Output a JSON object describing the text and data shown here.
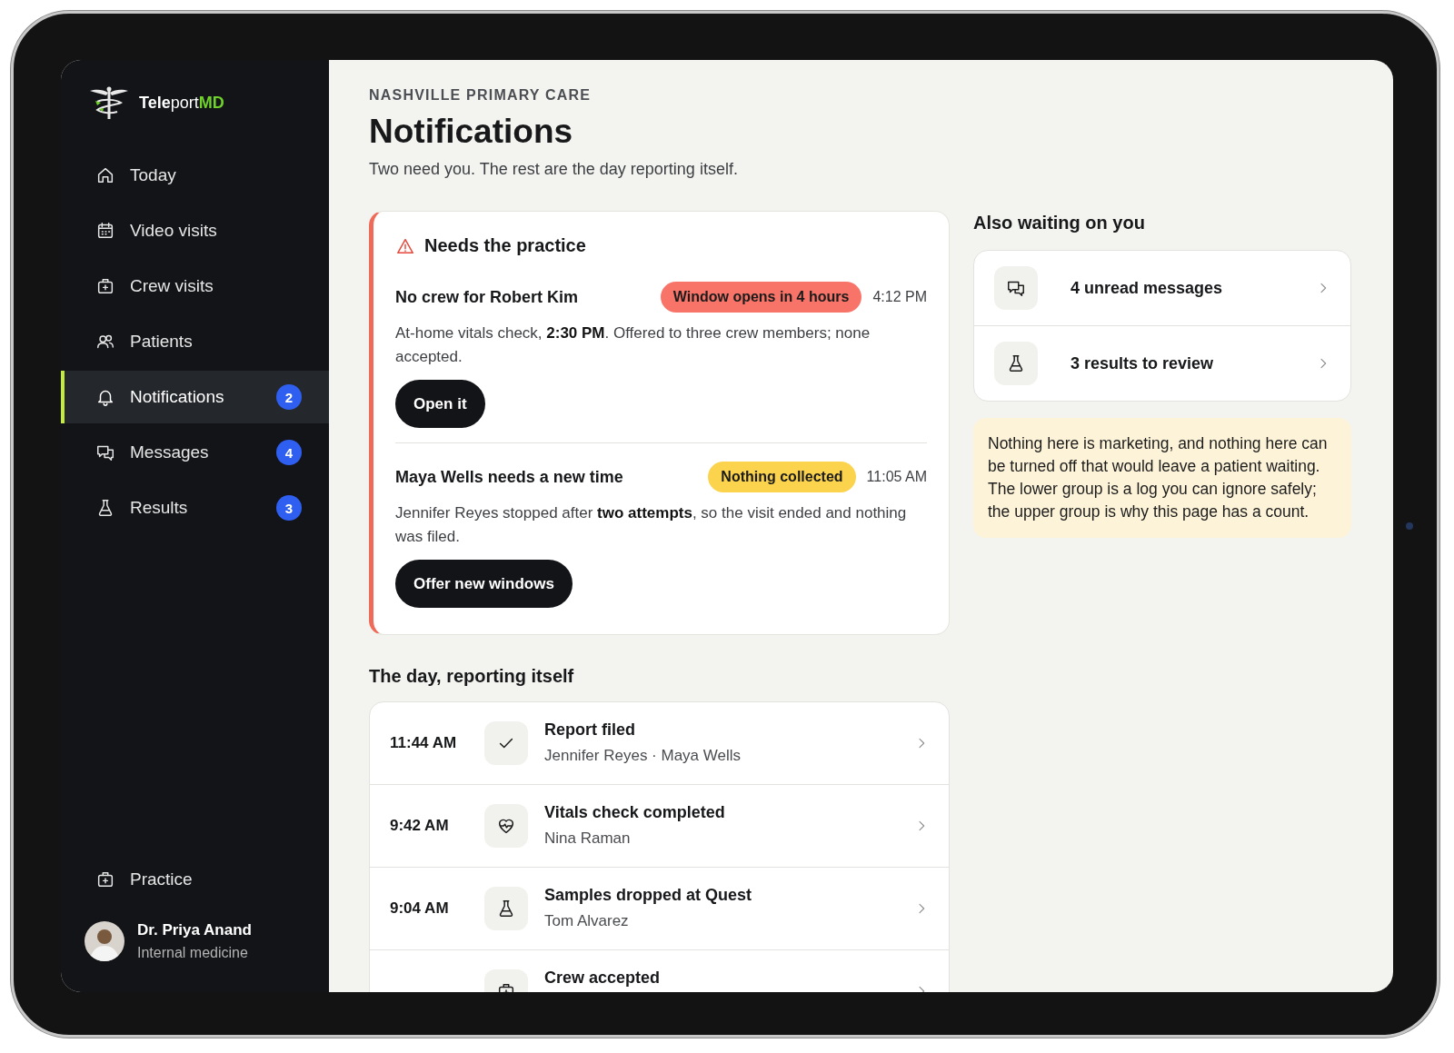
{
  "brand": {
    "name": "**Tele**port",
    "suffix": "MD"
  },
  "nav": [
    {
      "label": "Today",
      "kind": "home",
      "selected": false
    },
    {
      "label": "Video visits",
      "kind": "calendar",
      "selected": false
    },
    {
      "label": "Crew visits",
      "kind": "kit",
      "selected": false
    },
    {
      "label": "Patients",
      "kind": "people",
      "selected": false
    },
    {
      "label": "Notifications",
      "kind": "bell",
      "selected": true,
      "badge": "2"
    },
    {
      "label": "Messages",
      "kind": "chat",
      "selected": false,
      "badge": "4"
    },
    {
      "label": "Results",
      "kind": "flask",
      "selected": false,
      "badge": "3"
    }
  ],
  "footer_nav": {
    "label": "Practice",
    "kind": "kit"
  },
  "user": {
    "name": "Dr. Priya Anand",
    "role": "Internal medicine"
  },
  "header": {
    "eyebrow": "NASHVILLE PRIMARY CARE",
    "title": "Notifications",
    "subtitle": "Two need you. The rest are the day reporting itself."
  },
  "urgent": {
    "title": "Needs the practice",
    "items": [
      {
        "title": "No crew for Robert Kim",
        "tag": "Window opens in 4 hours",
        "color": "#f87468",
        "time": "4:12 PM",
        "body": "At-home vitals check, **2:30 PM**. Offered to three crew members; none accepted.",
        "action": "Open it"
      },
      {
        "title": "Maya Wells needs a new time",
        "tag": "Nothing collected",
        "color": "#fcd34d",
        "time": "11:05 AM",
        "body": "Jennifer Reyes stopped after **two attempts**, so the visit ended and nothing was filed.",
        "action": "Offer new windows"
      }
    ]
  },
  "waiting": {
    "title": "Also waiting on you",
    "items": [
      {
        "kind": "chat",
        "label": "4 unread messages"
      },
      {
        "kind": "flask",
        "label": "3 results to review"
      }
    ]
  },
  "note": "Nothing here is marketing, and nothing here can be turned off that would leave a patient waiting. The lower group is a log you can ignore safely; the upper group is why this page has a count.",
  "log": {
    "title": "The day, reporting itself",
    "rows": [
      {
        "time": "11:44 AM",
        "kind": "check",
        "title": "Report filed",
        "subtitle": "Jennifer Reyes · Maya Wells"
      },
      {
        "time": "9:42 AM",
        "kind": "heart",
        "title": "Vitals check completed",
        "subtitle": "Nina Raman"
      },
      {
        "time": "9:04 AM",
        "kind": "flask",
        "title": "Samples dropped at Quest",
        "subtitle": "Tom Alvarez"
      },
      {
        "kind": "kit",
        "title": "Crew accepted"
      }
    ]
  }
}
